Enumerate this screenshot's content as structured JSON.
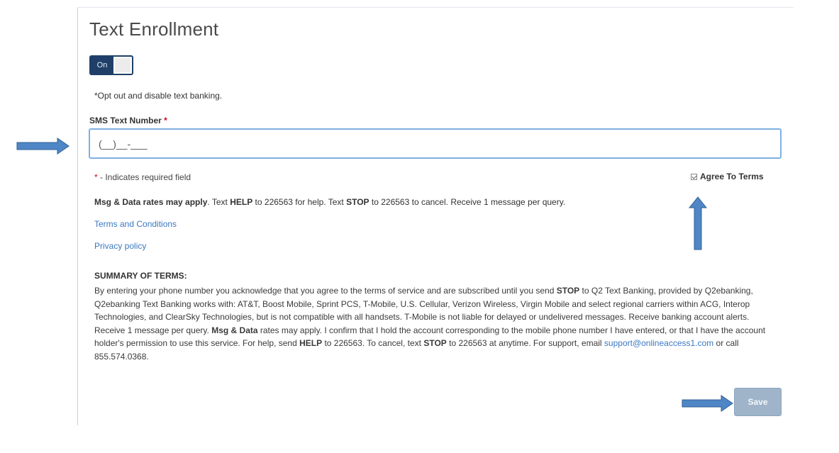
{
  "page": {
    "title": "Text Enrollment"
  },
  "toggle": {
    "label": "On",
    "state": "on"
  },
  "opt_out_text": "*Opt out and disable text banking.",
  "sms_field": {
    "label": "SMS Text Number",
    "required_marker": "*",
    "value": "(__)__-___"
  },
  "required_note": {
    "marker": "*",
    "text": " - Indicates required field"
  },
  "agree_terms": {
    "label": "Agree To Terms",
    "checked": true
  },
  "rates_line": {
    "bold_lead": "Msg & Data rates may apply",
    "part1": ". Text ",
    "help": "HELP",
    "part2": " to 226563 for help. Text ",
    "stop": "STOP",
    "part3": " to 226563 to cancel. Receive 1 message per query."
  },
  "links": {
    "terms": "Terms and Conditions",
    "privacy": "Privacy policy"
  },
  "summary": {
    "title": "SUMMARY OF TERMS:",
    "s1": "By entering your phone number you acknowledge that you agree to the terms of service and are subscribed until you send ",
    "b1": "STOP",
    "s2": " to Q2 Text Banking, provided by Q2ebanking, Q2ebanking Text Banking works with: AT&T, Boost Mobile, Sprint PCS, T-Mobile, U.S. Cellular, Verizon Wireless, Virgin Mobile and select regional carriers within ACG, Interop Technologies, and ClearSky Technologies, but is not compatible with all handsets. T-Mobile is not liable for delayed or undelivered messages. Receive banking account alerts. Receive 1 message per query. ",
    "b2": "Msg & Data",
    "s3": " rates may apply. I confirm that I hold the account corresponding to the mobile phone number I have entered, or that I have the account holder's permission to use this service. For help, send ",
    "b3": "HELP",
    "s4": " to 226563. To cancel, text ",
    "b4": "STOP",
    "s5": " to 226563 at anytime. For support, email ",
    "email": "support@onlineaccess1.com",
    "s6": " or call 855.574.0368."
  },
  "save_button": "Save",
  "colors": {
    "toggle_bg": "#1f3f68",
    "link": "#3a78c3",
    "required": "#d0021b",
    "input_border": "#7fb0e2",
    "save_bg": "#9fb4c8",
    "arrow": "#4f86c6"
  },
  "icons": {
    "annotation_arrows": [
      "arrow-right-icon",
      "arrow-up-icon",
      "arrow-right-icon"
    ],
    "checkbox": "check-icon"
  }
}
